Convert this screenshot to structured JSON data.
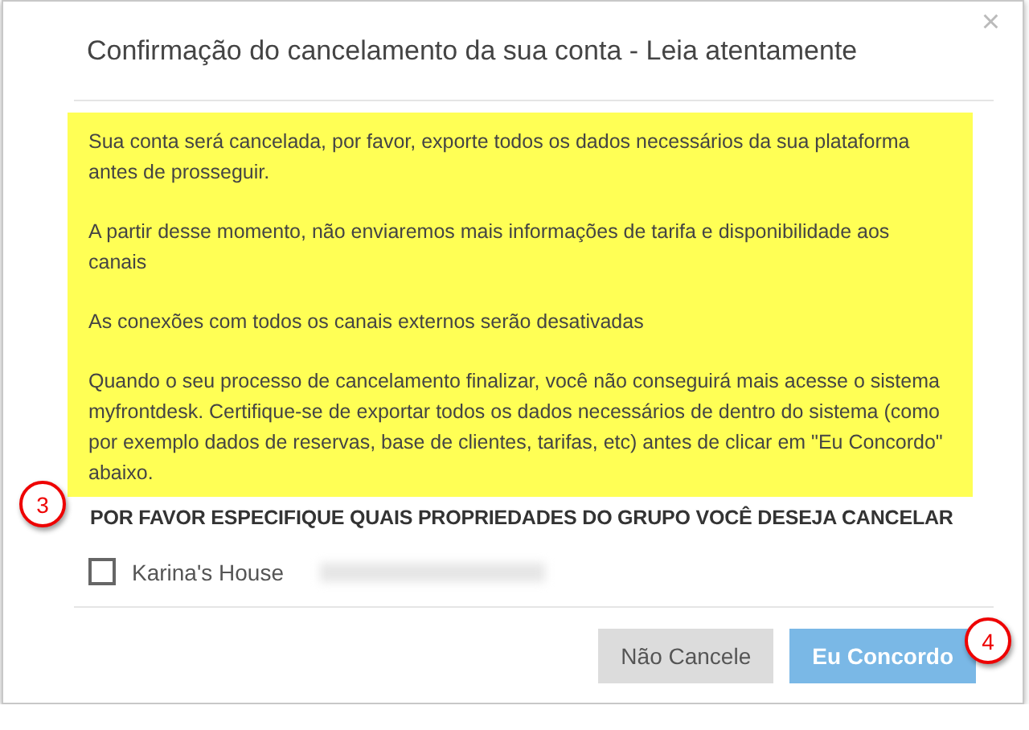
{
  "dialog": {
    "title": "Confirmação do cancelamento da sua conta - Leia atentamente",
    "close": "×"
  },
  "warning": [
    "Sua conta será cancelada, por favor, exporte todos os dados necessários da sua plataforma antes de prosseguir.",
    "A partir desse momento, não enviaremos mais informações de tarifa e disponibilidade aos canais",
    "As conexões com todos os canais externos serão desativadas",
    "Quando o seu processo de cancelamento finalizar, você não conseguirá mais acesse o sistema myfrontdesk. Certifique-se de exportar todos os dados necessários de dentro do sistema (como por exemplo dados de reservas, base de clientes, tarifas, etc) antes de clicar em \"Eu Concordo\" abaixo."
  ],
  "section_heading": "POR FAVOR ESPECIFIQUE QUAIS PROPRIEDADES DO GRUPO VOCÊ DESEJA CANCELAR",
  "properties": [
    {
      "name": "Karina's House",
      "checked": false
    }
  ],
  "buttons": [
    {
      "label": "Não Cancele",
      "kind": "secondary"
    },
    {
      "label": "Eu Concordo",
      "kind": "primary"
    }
  ],
  "callouts": [
    "3",
    "4"
  ]
}
